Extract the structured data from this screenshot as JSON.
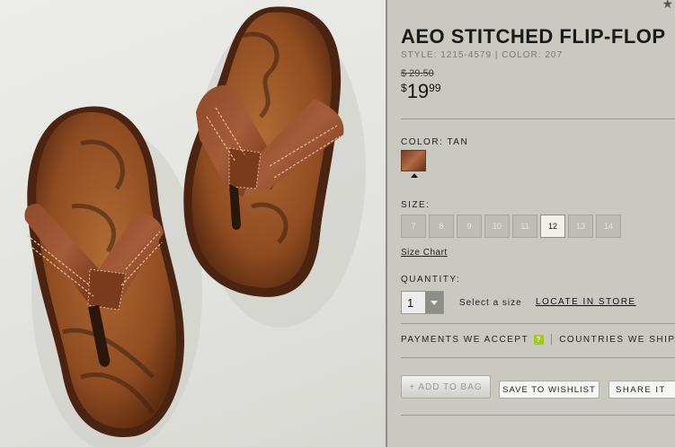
{
  "product": {
    "title": "AEO STITCHED FLIP-FLOP",
    "style_line": "STYLE: 1215-4579 | COLOR: 207",
    "old_price": "$ 29.50",
    "price_currency": "$",
    "price_dollars": "19",
    "price_cents": "99"
  },
  "color": {
    "label": "COLOR: TAN",
    "swatch_color": "#9a5634"
  },
  "size": {
    "label": "SIZE:",
    "options": [
      "7",
      "8",
      "9",
      "10",
      "11",
      "12",
      "13",
      "14"
    ],
    "selected": "12",
    "size_chart_link": "Size Chart"
  },
  "quantity": {
    "label": "QUANTITY:",
    "value": "1",
    "select_size_text": "Select a size",
    "locate_link": "LOCATE IN STORE"
  },
  "info": {
    "payments": "PAYMENTS WE ACCEPT",
    "payments_help": "?",
    "countries": "COUNTRIES WE SHIP TO"
  },
  "actions": {
    "add_to_bag": "+ ADD TO BAG",
    "save_to_wishlist": "SAVE TO WISHLIST",
    "share_it": "SHARE IT"
  },
  "icons": {
    "corner": "star-icon",
    "help": "question-icon",
    "dropdown": "chevron-down-icon"
  },
  "colors": {
    "panel_bg": "#c9c9bf",
    "accent_green": "#9ccc1c"
  }
}
